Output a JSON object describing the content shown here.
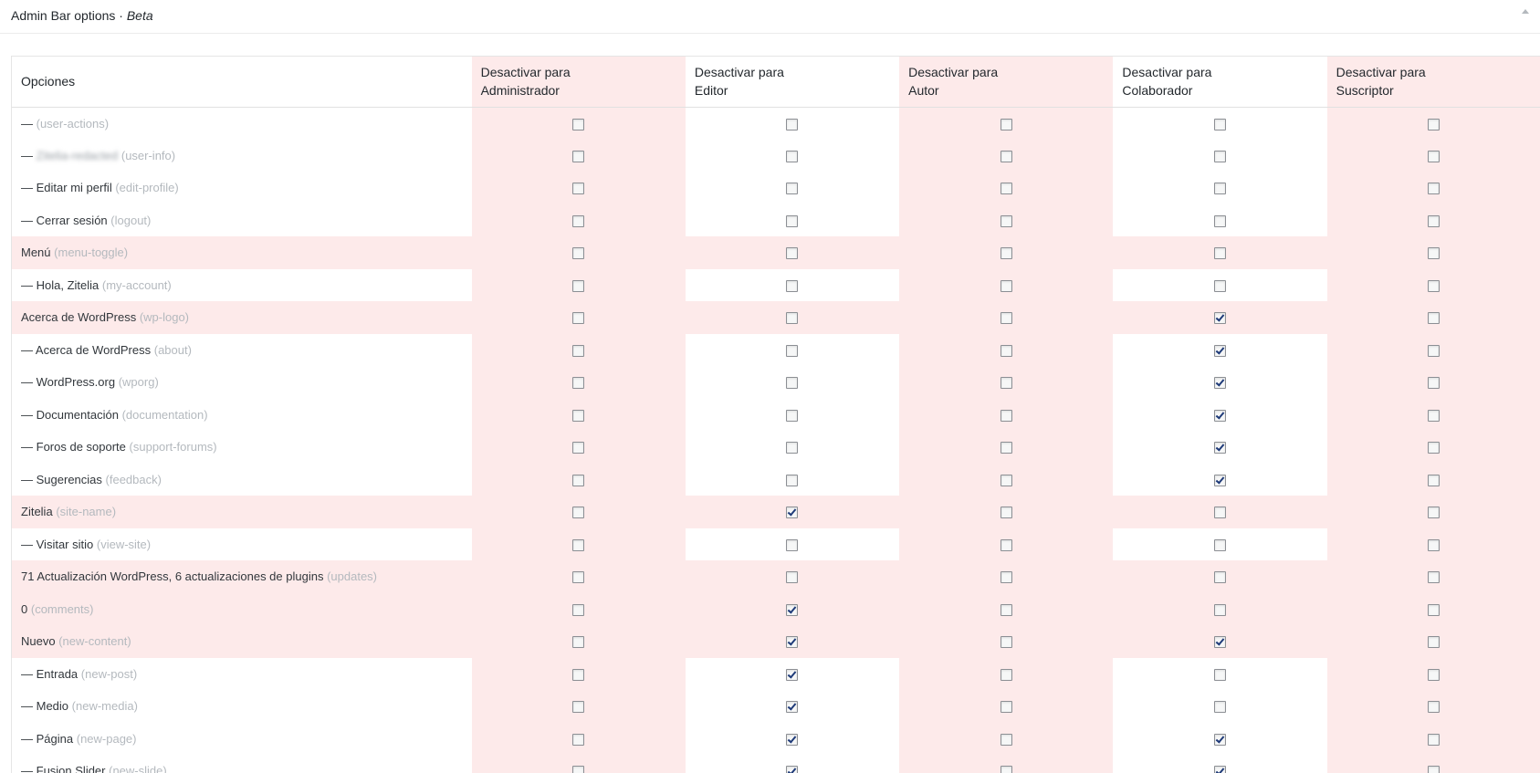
{
  "panel": {
    "title": "Admin Bar options · ",
    "title_em": "Beta"
  },
  "columns": {
    "option": "Opciones",
    "roles": [
      {
        "line1": "Desactivar para",
        "line2": "Administrador"
      },
      {
        "line1": "Desactivar para",
        "line2": "Editor"
      },
      {
        "line1": "Desactivar para",
        "line2": "Autor"
      },
      {
        "line1": "Desactivar para",
        "line2": "Colaborador"
      },
      {
        "line1": "Desactivar para",
        "line2": "Suscriptor"
      }
    ]
  },
  "rows": [
    {
      "kind": "sub",
      "prefix": "— ",
      "label": "",
      "slug": "(user-actions)",
      "blur": "",
      "checks": [
        false,
        false,
        false,
        false,
        false
      ]
    },
    {
      "kind": "sub",
      "prefix": "— ",
      "label": "",
      "slug": "(user-info)",
      "blur": "Zitelia-redacted",
      "checks": [
        false,
        false,
        false,
        false,
        false
      ]
    },
    {
      "kind": "sub",
      "prefix": "— ",
      "label": "Editar mi perfil",
      "slug": "(edit-profile)",
      "blur": "",
      "checks": [
        false,
        false,
        false,
        false,
        false
      ]
    },
    {
      "kind": "sub",
      "prefix": "— ",
      "label": "Cerrar sesión",
      "slug": "(logout)",
      "blur": "",
      "checks": [
        false,
        false,
        false,
        false,
        false
      ]
    },
    {
      "kind": "top",
      "prefix": "",
      "label": "Menú",
      "slug": "(menu-toggle)",
      "blur": "",
      "checks": [
        false,
        false,
        false,
        false,
        false
      ]
    },
    {
      "kind": "sub",
      "prefix": "— ",
      "label": "Hola, Zitelia",
      "slug": "(my-account)",
      "blur": "",
      "checks": [
        false,
        false,
        false,
        false,
        false
      ]
    },
    {
      "kind": "top",
      "prefix": "",
      "label": "Acerca de WordPress",
      "slug": "(wp-logo)",
      "blur": "",
      "checks": [
        false,
        false,
        false,
        true,
        false
      ]
    },
    {
      "kind": "sub",
      "prefix": "— ",
      "label": "Acerca de WordPress",
      "slug": "(about)",
      "blur": "",
      "checks": [
        false,
        false,
        false,
        true,
        false
      ]
    },
    {
      "kind": "sub",
      "prefix": "— ",
      "label": "WordPress.org",
      "slug": "(wporg)",
      "blur": "",
      "checks": [
        false,
        false,
        false,
        true,
        false
      ]
    },
    {
      "kind": "sub",
      "prefix": "— ",
      "label": "Documentación",
      "slug": "(documentation)",
      "blur": "",
      "checks": [
        false,
        false,
        false,
        true,
        false
      ]
    },
    {
      "kind": "sub",
      "prefix": "— ",
      "label": "Foros de soporte",
      "slug": "(support-forums)",
      "blur": "",
      "checks": [
        false,
        false,
        false,
        true,
        false
      ]
    },
    {
      "kind": "sub",
      "prefix": "— ",
      "label": "Sugerencias",
      "slug": "(feedback)",
      "blur": "",
      "checks": [
        false,
        false,
        false,
        true,
        false
      ]
    },
    {
      "kind": "top",
      "prefix": "",
      "label": "Zitelia",
      "slug": "(site-name)",
      "blur": "",
      "checks": [
        false,
        true,
        false,
        false,
        false
      ]
    },
    {
      "kind": "sub",
      "prefix": "— ",
      "label": "Visitar sitio",
      "slug": "(view-site)",
      "blur": "",
      "checks": [
        false,
        false,
        false,
        false,
        false
      ]
    },
    {
      "kind": "top",
      "prefix": "",
      "label": "71 Actualización WordPress, 6 actualizaciones de plugins",
      "slug": "(updates)",
      "blur": "",
      "checks": [
        false,
        false,
        false,
        false,
        false
      ]
    },
    {
      "kind": "top",
      "prefix": "",
      "label": "0",
      "slug": "(comments)",
      "blur": "",
      "checks": [
        false,
        true,
        false,
        false,
        false
      ]
    },
    {
      "kind": "top",
      "prefix": "",
      "label": "Nuevo",
      "slug": "(new-content)",
      "blur": "",
      "checks": [
        false,
        true,
        false,
        true,
        false
      ]
    },
    {
      "kind": "sub",
      "prefix": "— ",
      "label": "Entrada",
      "slug": "(new-post)",
      "blur": "",
      "checks": [
        false,
        true,
        false,
        false,
        false
      ]
    },
    {
      "kind": "sub",
      "prefix": "— ",
      "label": "Medio",
      "slug": "(new-media)",
      "blur": "",
      "checks": [
        false,
        true,
        false,
        false,
        false
      ]
    },
    {
      "kind": "sub",
      "prefix": "— ",
      "label": "Página",
      "slug": "(new-page)",
      "blur": "",
      "checks": [
        false,
        true,
        false,
        true,
        false
      ]
    },
    {
      "kind": "sub",
      "prefix": "— ",
      "label": "Fusion Slider",
      "slug": "(new-slide)",
      "blur": "",
      "checks": [
        false,
        true,
        false,
        true,
        false
      ]
    }
  ],
  "colors": {
    "stripe": "#fdeaea",
    "slug": "#b4b9be",
    "check": "#1e3a78"
  },
  "icons": {
    "panel_toggle": "collapse-arrow-icon"
  }
}
